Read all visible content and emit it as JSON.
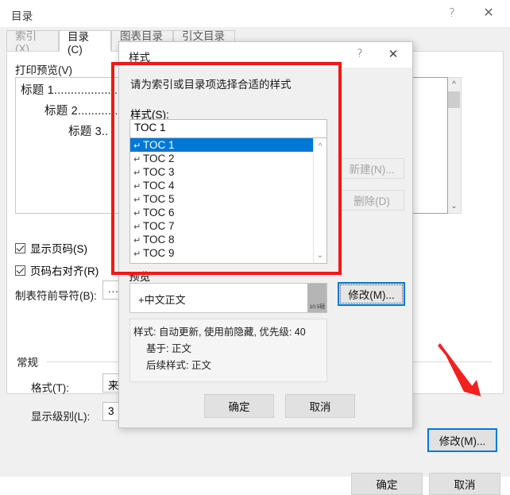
{
  "outer_window": {
    "title": "目录",
    "help_icon": "?",
    "close_icon": "✕",
    "tabs": [
      {
        "label": "索引(X)",
        "active": false
      },
      {
        "label": "目录(C)",
        "active": true
      },
      {
        "label": "图表目录(F)",
        "active": false
      },
      {
        "label": "引文目录(A)",
        "active": false
      }
    ],
    "print_preview_label": "打印预览(V)",
    "print_preview_lines": [
      "标题 1..........................",
      "标题 2..................",
      "标题 3.."
    ],
    "checkboxes": [
      {
        "label": "显示页码(S)",
        "checked": true
      },
      {
        "label": "页码右对齐(R)",
        "checked": true
      }
    ],
    "tab_leader": {
      "label": "制表符前导符(B):",
      "value": "........"
    },
    "general": {
      "group_label": "常规",
      "format": {
        "label": "格式(T):",
        "value": "来自模板"
      },
      "levels": {
        "label": "显示级别(L):",
        "value": "3"
      }
    },
    "modify_button": "修改(M)...",
    "ok_button": "确定",
    "cancel_button": "取消"
  },
  "style_dialog": {
    "title": "样式",
    "help_icon": "?",
    "close_icon": "✕",
    "prompt": "请为索引或目录项选择合适的样式",
    "styles_label": "样式(S):",
    "styles_value": "TOC 1",
    "style_items": [
      {
        "mark": "↵",
        "label": "TOC 1",
        "selected": true
      },
      {
        "mark": "↵",
        "label": "TOC 2",
        "selected": false
      },
      {
        "mark": "↵",
        "label": "TOC 3",
        "selected": false
      },
      {
        "mark": "↵",
        "label": "TOC 4",
        "selected": false
      },
      {
        "mark": "↵",
        "label": "TOC 5",
        "selected": false
      },
      {
        "mark": "↵",
        "label": "TOC 6",
        "selected": false
      },
      {
        "mark": "↵",
        "label": "TOC 7",
        "selected": false
      },
      {
        "mark": "↵",
        "label": "TOC 8",
        "selected": false
      },
      {
        "mark": "↵",
        "label": "TOC 9",
        "selected": false
      }
    ],
    "new_button": "新建(N)...",
    "delete_button": "删除(D)",
    "preview_label": "预览",
    "preview_sample": "+中文正文",
    "preview_size": "10.5磅",
    "description": [
      "样式: 自动更新, 使用前隐藏, 优先级: 40",
      "基于: 正文",
      "后续样式: 正文"
    ],
    "modify_button": "修改(M)...",
    "ok_button": "确定",
    "cancel_button": "取消"
  },
  "annotations": {
    "highlight_color": "#f51616",
    "arrow_color": "#f42020"
  },
  "colors": {
    "selection_blue": "#0078d7",
    "dialog_bg": "#f0f0f0",
    "button_bg": "#e1e1e1"
  }
}
